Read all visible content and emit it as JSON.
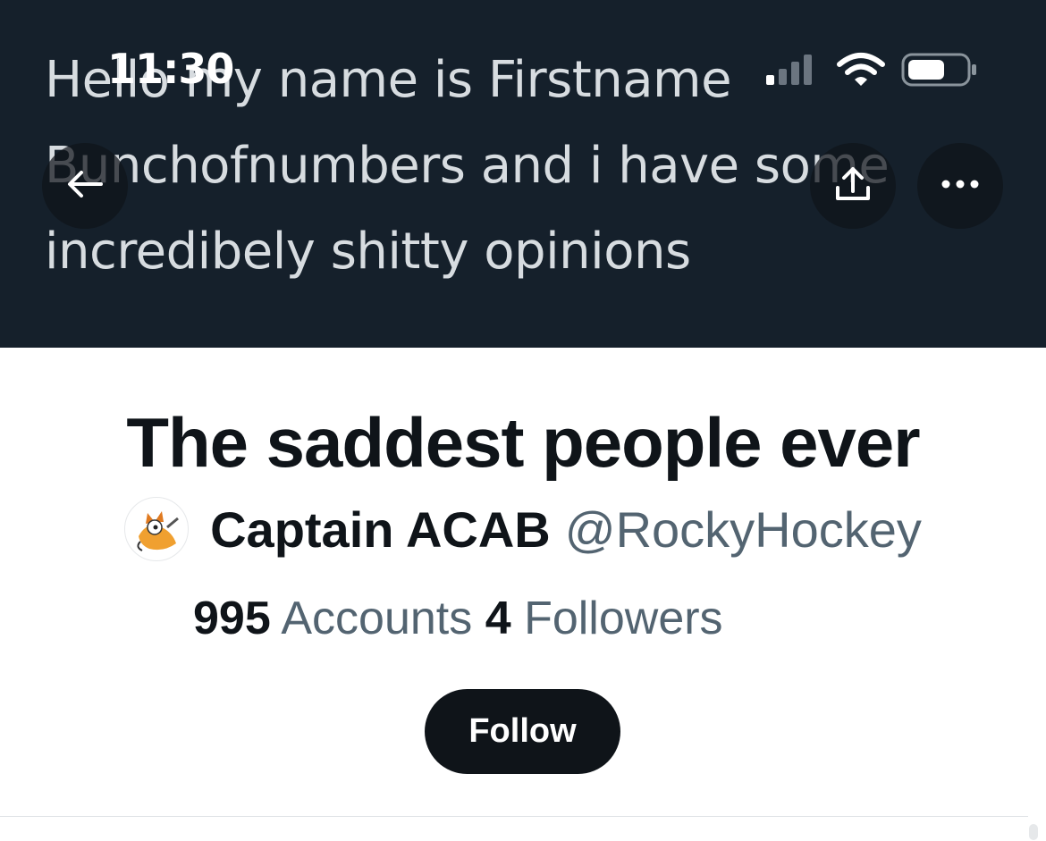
{
  "status_bar": {
    "time": "11:30",
    "signal_icon": "cellular-signal-icon",
    "wifi_icon": "wifi-icon",
    "battery_icon": "battery-icon"
  },
  "banner": {
    "lines": [
      "Hello my name is Firstname",
      "Bunchofnumbers and i have some",
      "incredibely shitty opinions"
    ],
    "background": "#15202b"
  },
  "nav": {
    "back_icon": "arrow-left-icon",
    "share_icon": "share-upload-icon",
    "more_icon": "more-dots-icon"
  },
  "list": {
    "title": "The saddest people ever",
    "owner_name": "Captain ACAB",
    "owner_handle": "@RockyHockey",
    "members_count": "995",
    "members_label": "Accounts",
    "followers_count": "4",
    "followers_label": "Followers",
    "follow_label": "Follow"
  },
  "colors": {
    "primary_text": "#0f1419",
    "secondary_text": "#536471",
    "button_bg": "#0f1419"
  }
}
